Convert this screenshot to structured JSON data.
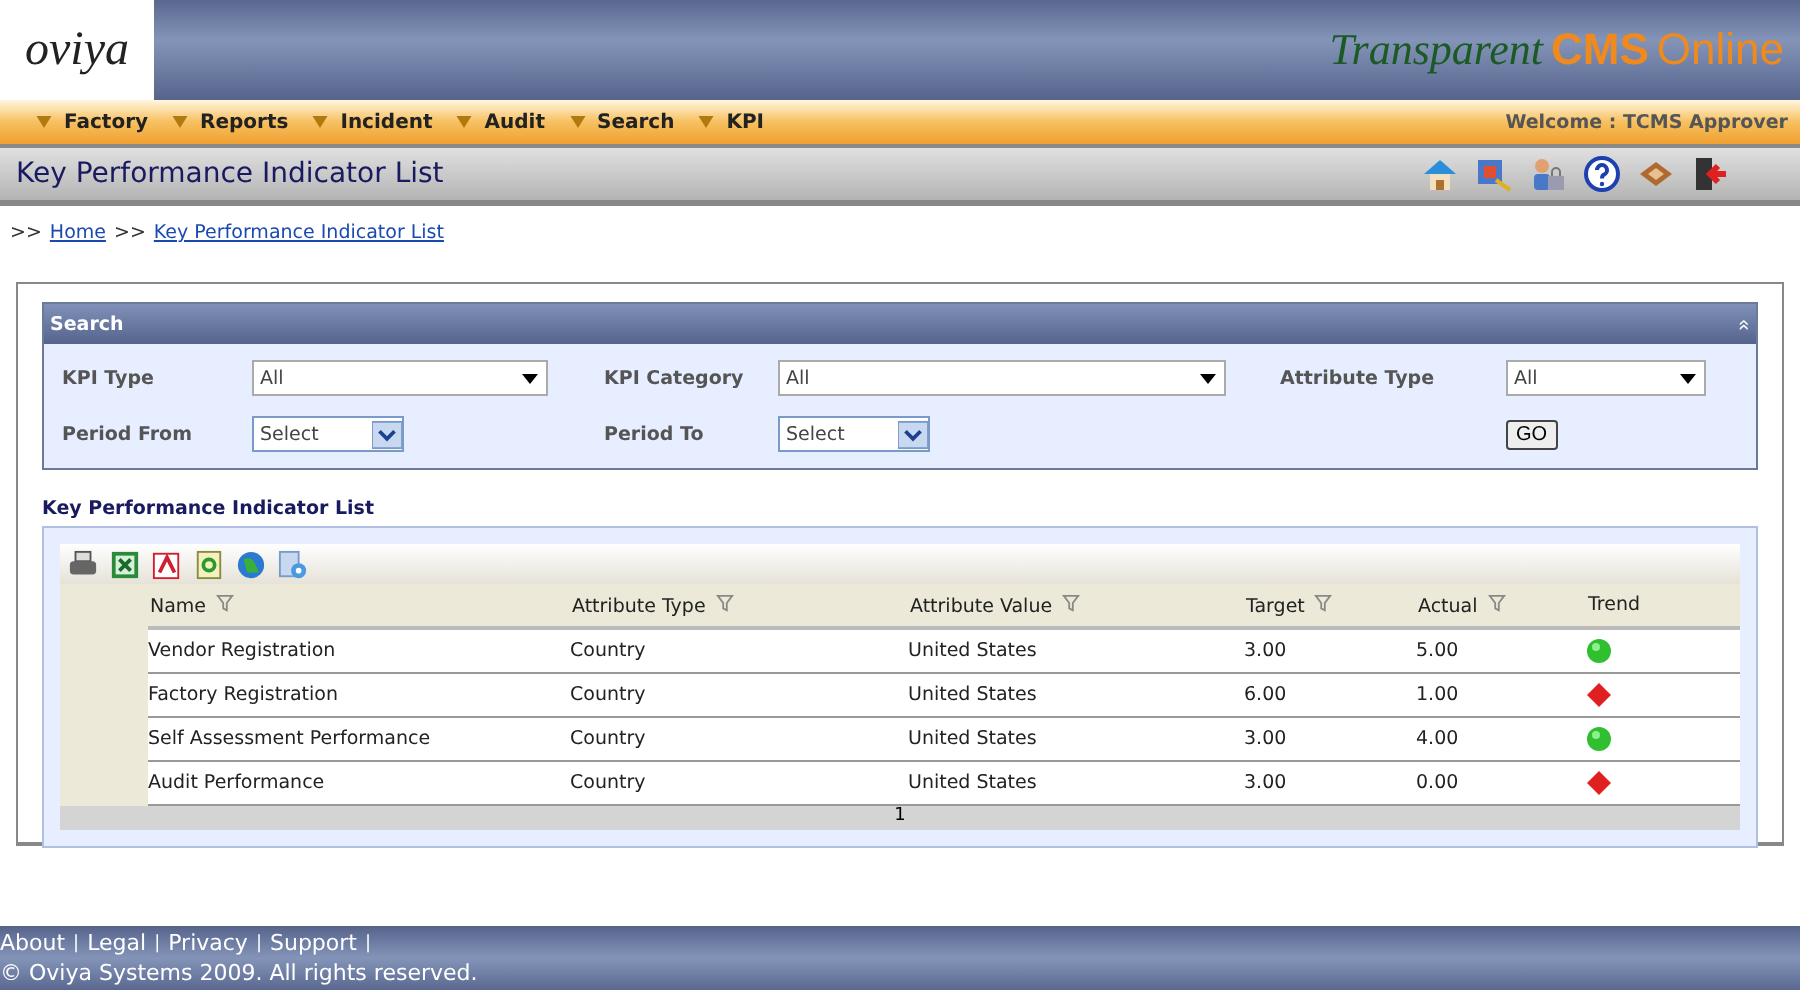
{
  "header": {
    "logo": "oviya",
    "brand_script": "Transparent",
    "brand_bold": "CMS",
    "brand_tail": "Online"
  },
  "menu": [
    "Factory",
    "Reports",
    "Incident",
    "Audit",
    "Search",
    "KPI"
  ],
  "welcome": "Welcome : TCMS Approver",
  "page_title": "Key Performance Indicator List",
  "breadcrumb": {
    "separator": ">>",
    "links": [
      "Home",
      "Key Performance Indicator List"
    ]
  },
  "search": {
    "title": "Search",
    "collapse_glyph": "»",
    "fields": [
      {
        "label": "KPI Type",
        "value": "All",
        "kind": "wide"
      },
      {
        "label": "KPI Category",
        "value": "All",
        "kind": "wider"
      },
      {
        "label": "Attribute Type",
        "value": "All",
        "kind": "medium"
      },
      {
        "label": "Period From",
        "value": "Select",
        "kind": "small"
      },
      {
        "label": "Period To",
        "value": "Select",
        "kind": "small"
      }
    ],
    "button": "GO"
  },
  "list": {
    "title": "Key Performance Indicator List",
    "columns": [
      {
        "label": "Name",
        "filter": true
      },
      {
        "label": "Attribute Type",
        "filter": true
      },
      {
        "label": "Attribute Value",
        "filter": true
      },
      {
        "label": "Target",
        "filter": true
      },
      {
        "label": "Actual",
        "filter": true
      },
      {
        "label": "Trend",
        "filter": false
      }
    ],
    "rows": [
      {
        "name": "Vendor Registration",
        "attribute_type": "Country",
        "attribute_value": "United States",
        "target": "3.00",
        "actual": "5.00",
        "kind": "up"
      },
      {
        "name": "Factory Registration",
        "attribute_type": "Country",
        "attribute_value": "United States",
        "target": "6.00",
        "actual": "1.00",
        "kind": "down"
      },
      {
        "name": "Self Assessment Performance",
        "attribute_type": "Country",
        "attribute_value": "United States",
        "target": "3.00",
        "actual": "4.00",
        "kind": "up"
      },
      {
        "name": "Audit Performance",
        "attribute_type": "Country",
        "attribute_value": "United States",
        "target": "3.00",
        "actual": "0.00",
        "kind": "down"
      }
    ],
    "page": "1"
  },
  "footer": {
    "links": [
      "About",
      "Legal",
      "Privacy",
      "Support"
    ],
    "separator": "|",
    "copyright": "© Oviya Systems 2009. All rights reserved."
  }
}
